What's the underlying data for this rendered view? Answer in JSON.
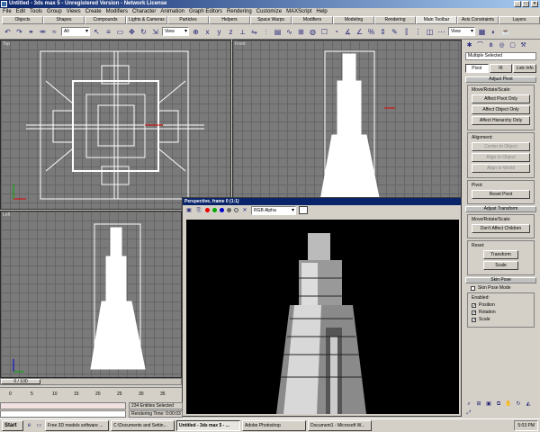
{
  "window": {
    "title": "Untitled - 3ds max 5 - Unregistered Version - Network License"
  },
  "menu": [
    "File",
    "Edit",
    "Tools",
    "Group",
    "Views",
    "Create",
    "Modifiers",
    "Character",
    "Animation",
    "Graph Editors",
    "Rendering",
    "Customize",
    "MAXScript",
    "Help"
  ],
  "tabs": [
    "Objects",
    "Shapes",
    "Compounds",
    "Lights & Cameras",
    "Particles",
    "Helpers",
    "Space Warps",
    "Modifiers",
    "Modeling",
    "Rendering",
    "Main Toolbar",
    "Axis Constraints",
    "Layers"
  ],
  "active_tab": "Main Toolbar",
  "toolbar": {
    "selection_filter": "All",
    "ref_coord": "View",
    "ref_coord2": "View"
  },
  "viewports": {
    "top": "Top",
    "front": "Front",
    "left": "Left"
  },
  "command_panel": {
    "selection_name": "Multiple Selected",
    "tabs": [
      "Pivot",
      "IK",
      "Link Info"
    ],
    "adjust_pivot": {
      "header": "Adjust Pivot",
      "move_label": "Move/Rotate/Scale:",
      "buttons": [
        "Affect Pivot Only",
        "Affect Object Only",
        "Affect Hierarchy Only"
      ],
      "alignment_label": "Alignment:",
      "align_buttons": [
        "Center to Object",
        "Align to Object",
        "Align to World"
      ],
      "pivot_label": "Pivot:",
      "reset_pivot": "Reset Pivot"
    },
    "adjust_transform": {
      "header": "Adjust Transform",
      "move_label": "Move/Rotate/Scale:",
      "dont_affect": "Don't Affect Children",
      "reset_label": "Reset:",
      "transform": "Transform",
      "scale": "Scale"
    },
    "skin_pose": {
      "header": "Skin Pose",
      "mode": "Skin Pose Mode",
      "enabled_label": "Enabled:",
      "position": "Position",
      "rotation": "Rotation",
      "scale": "Scale"
    }
  },
  "render_window": {
    "title": "Perspective, frame 0 (1:1)",
    "channel": "RGB Alpha"
  },
  "timeline": {
    "frame": "0 / 100",
    "ticks": [
      "0",
      "5",
      "10",
      "15",
      "20",
      "25",
      "30",
      "35"
    ]
  },
  "status": {
    "selection": "234 Entities Selected",
    "render_time": "Rendering Time: 0:00:03"
  },
  "taskbar": {
    "start": "Start",
    "tasks": [
      "Free 3D models software ...",
      "C:\\Documents and Settin...",
      "Untitled - 3ds max 5 - ...",
      "Adobe Photoshop",
      "Document1 - Microsoft W..."
    ],
    "active_index": 2,
    "clock": "5:03 PM"
  }
}
